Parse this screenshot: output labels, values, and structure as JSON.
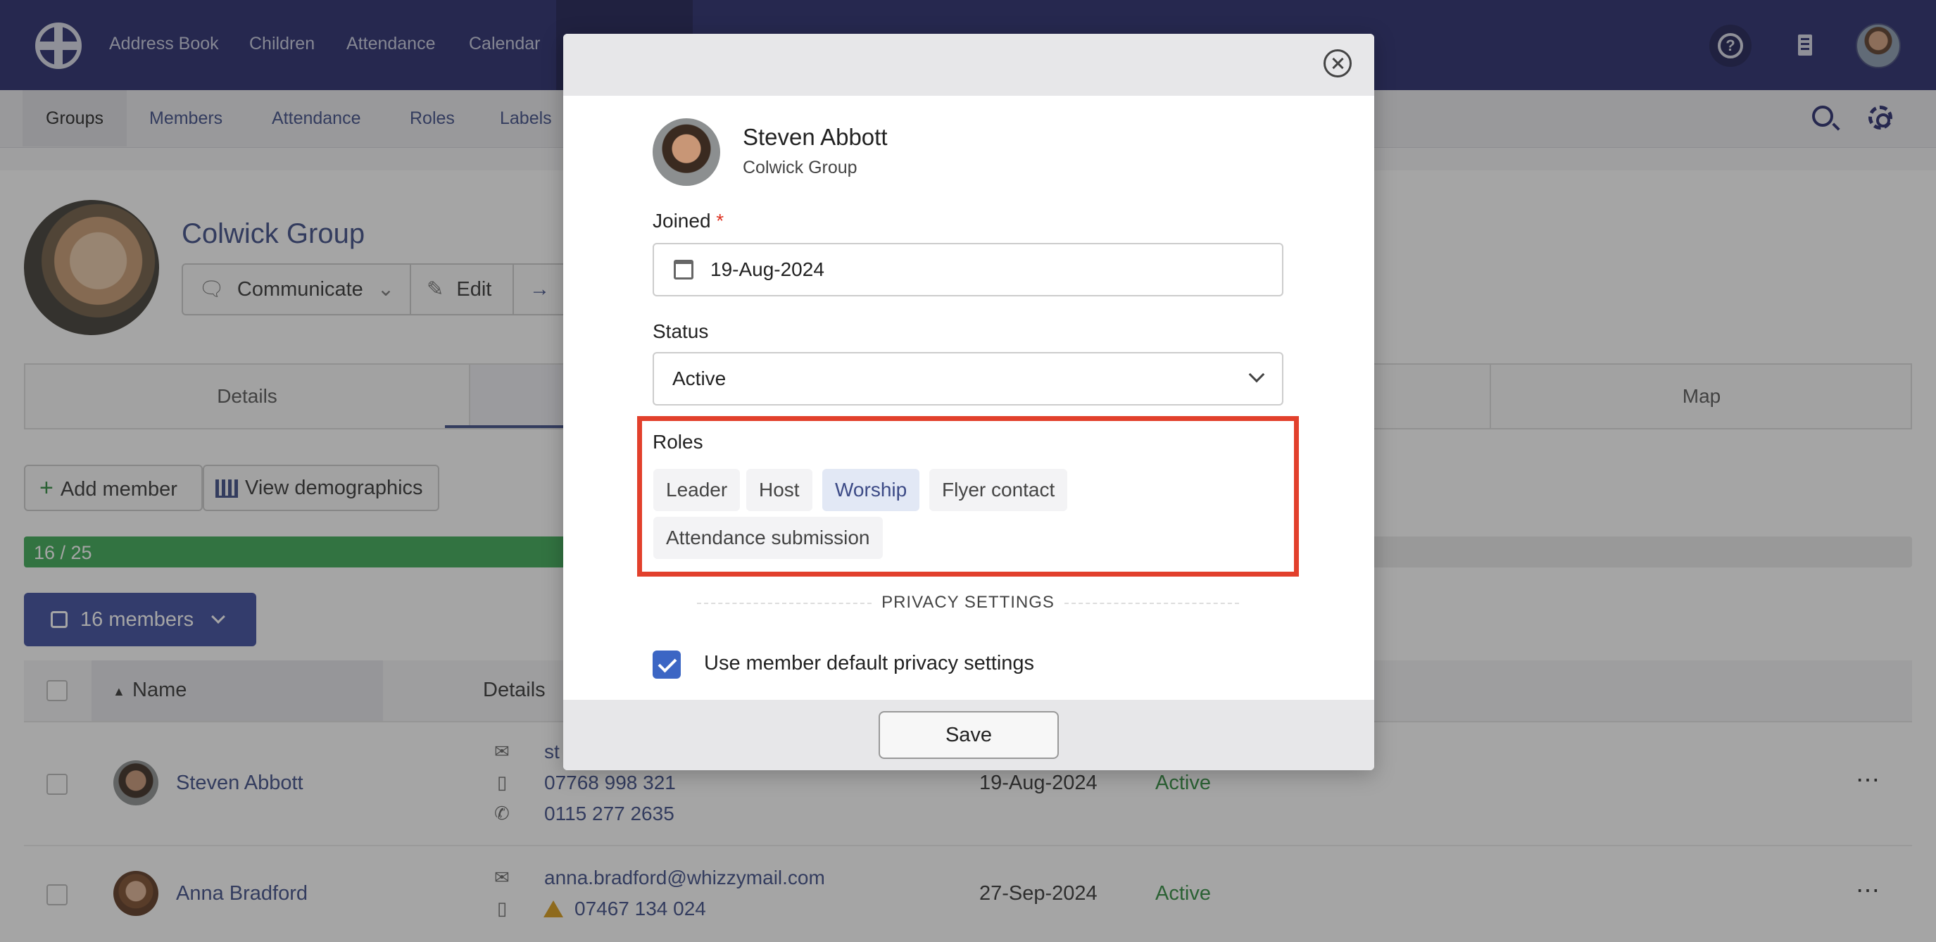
{
  "topnav": {
    "items": [
      "Address Book",
      "Children",
      "Attendance",
      "Calendar"
    ]
  },
  "subnav": {
    "tabs": [
      "Groups",
      "Members",
      "Attendance",
      "Roles",
      "Labels"
    ]
  },
  "group": {
    "title": "Colwick Group",
    "buttons": {
      "communicate": "Communicate",
      "edit": "Edit"
    }
  },
  "tabs": {
    "details": "Details",
    "map": "Map"
  },
  "actions": {
    "add_member": "Add member",
    "view_demographics": "View demographics"
  },
  "progress": {
    "label": "16 / 25",
    "fraction": 0.64
  },
  "members_button": "16 members",
  "table": {
    "headers": {
      "name": "Name",
      "details": "Details"
    },
    "rows": [
      {
        "name": "Steven Abbott",
        "email": "st",
        "mobile": "07768 998 321",
        "phone": "0115 277 2635",
        "joined": "19-Aug-2024",
        "status": "Active"
      },
      {
        "name": "Anna Bradford",
        "email": "anna.bradford@whizzymail.com",
        "mobile": "07467 134 024",
        "joined": "27-Sep-2024",
        "status": "Active"
      }
    ]
  },
  "modal": {
    "person_name": "Steven Abbott",
    "person_group": "Colwick Group",
    "joined_label": "Joined",
    "required_mark": "*",
    "joined_value": "19-Aug-2024",
    "status_label": "Status",
    "status_value": "Active",
    "roles_label": "Roles",
    "roles": [
      "Leader",
      "Host",
      "Worship",
      "Flyer contact",
      "Attendance submission"
    ],
    "selected_role": "Worship",
    "privacy_heading": "PRIVACY SETTINGS",
    "privacy_checkbox_label": "Use member default privacy settings",
    "save_label": "Save"
  },
  "colors": {
    "nav_bg": "#25286b",
    "accent": "#3c4a86",
    "highlight_border": "#e2402c",
    "status_active": "#2e8b3d",
    "progress_fill": "#3aaa53"
  }
}
